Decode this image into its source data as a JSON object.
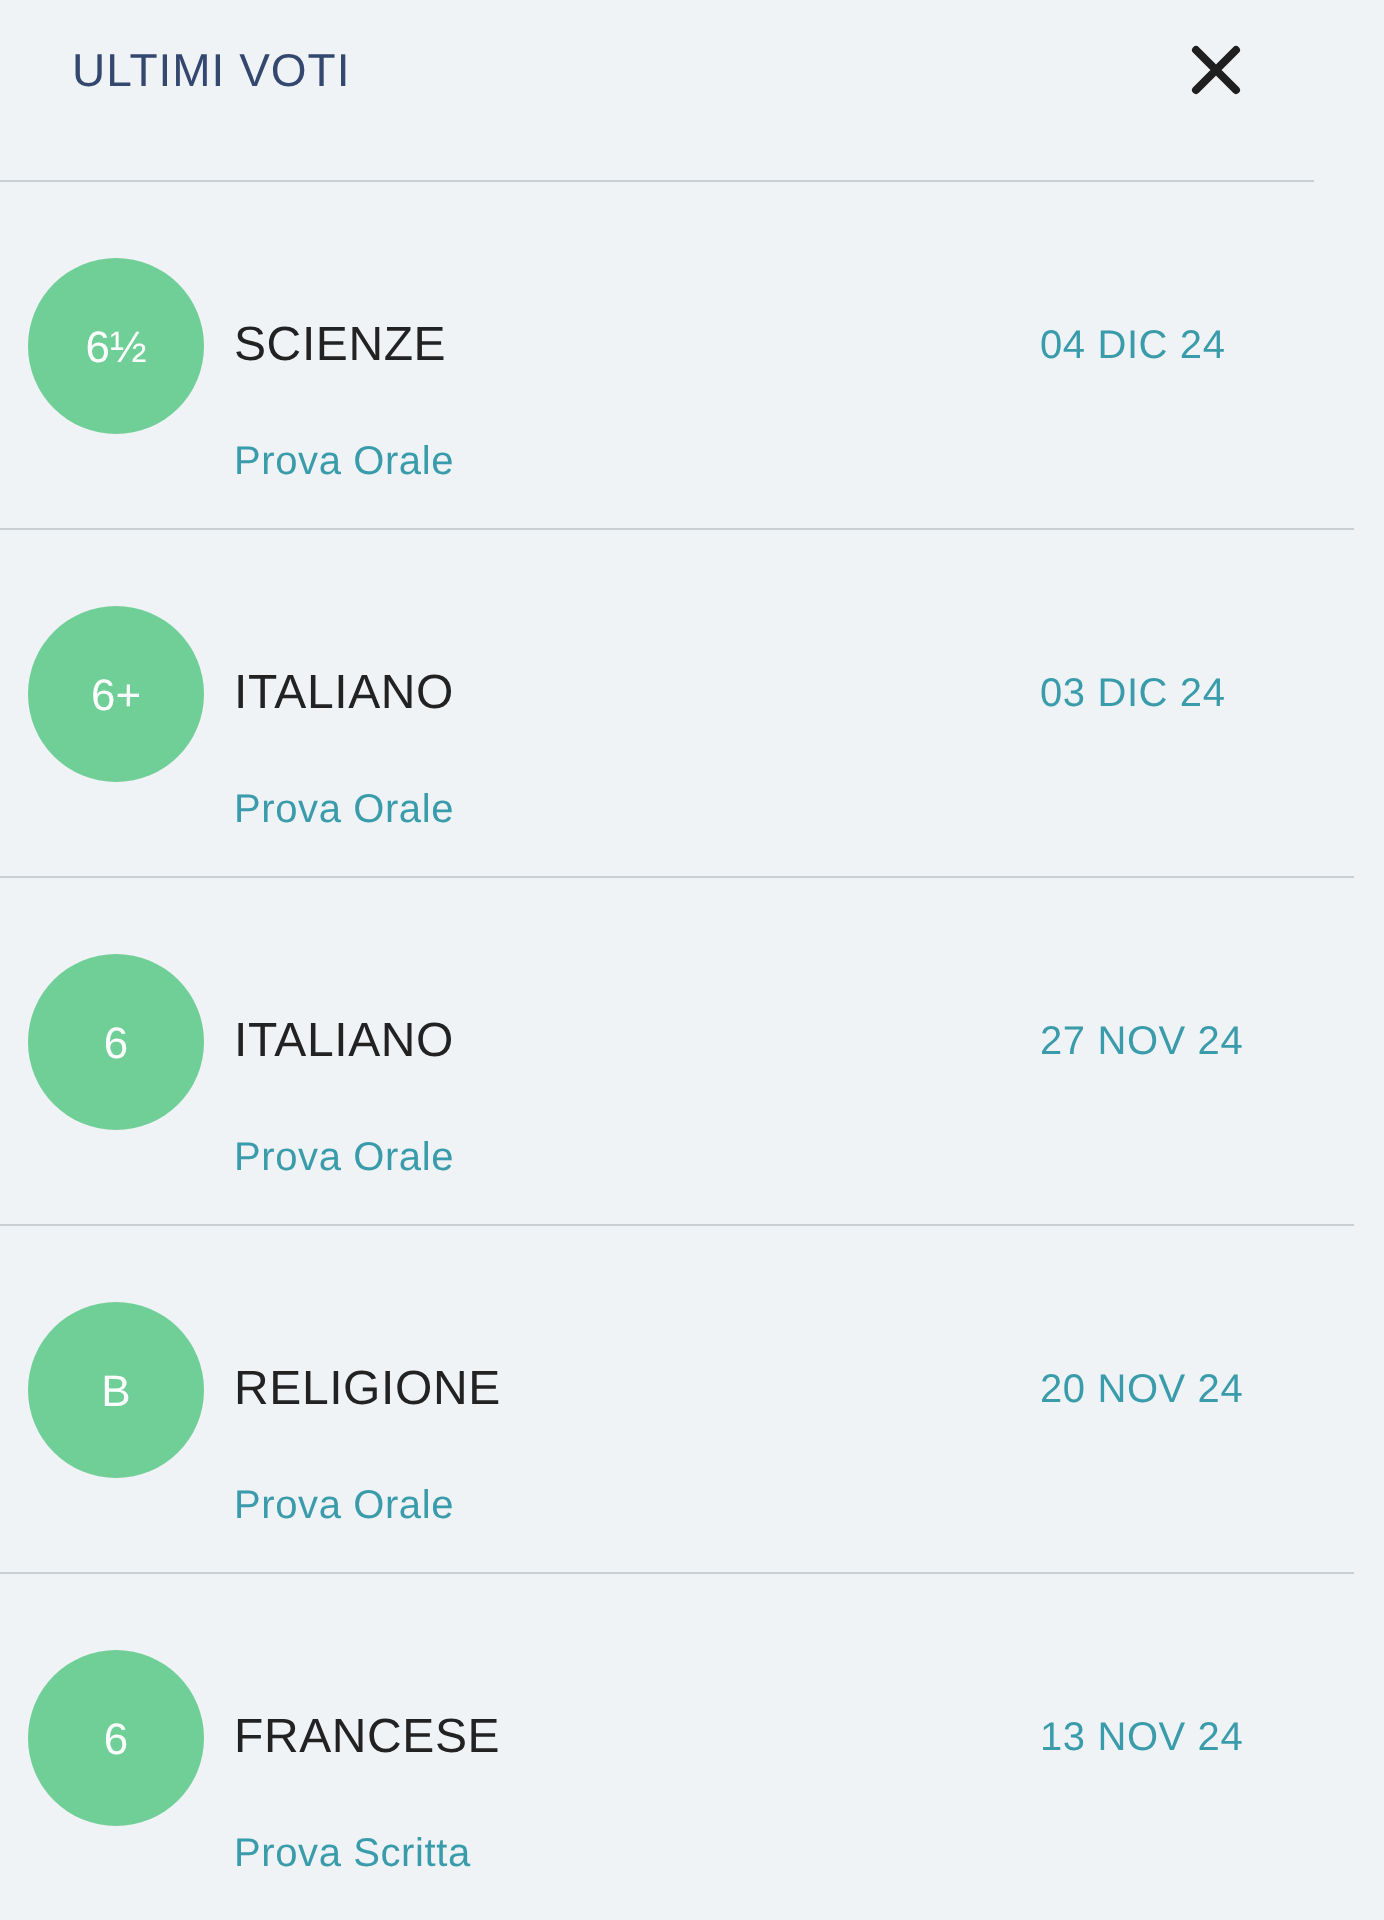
{
  "header": {
    "title": "ULTIMI VOTI"
  },
  "grades": [
    {
      "grade": "6½",
      "subject": "SCIENZE",
      "date": "04 DIC 24",
      "type": "Prova Orale"
    },
    {
      "grade": "6+",
      "subject": "ITALIANO",
      "date": "03 DIC 24",
      "type": "Prova Orale"
    },
    {
      "grade": "6",
      "subject": "ITALIANO",
      "date": "27 NOV 24",
      "type": "Prova Orale"
    },
    {
      "grade": "B",
      "subject": "RELIGIONE",
      "date": "20 NOV 24",
      "type": "Prova Orale"
    },
    {
      "grade": "6",
      "subject": "FRANCESE",
      "date": "13 NOV 24",
      "type": "Prova Scritta"
    }
  ]
}
